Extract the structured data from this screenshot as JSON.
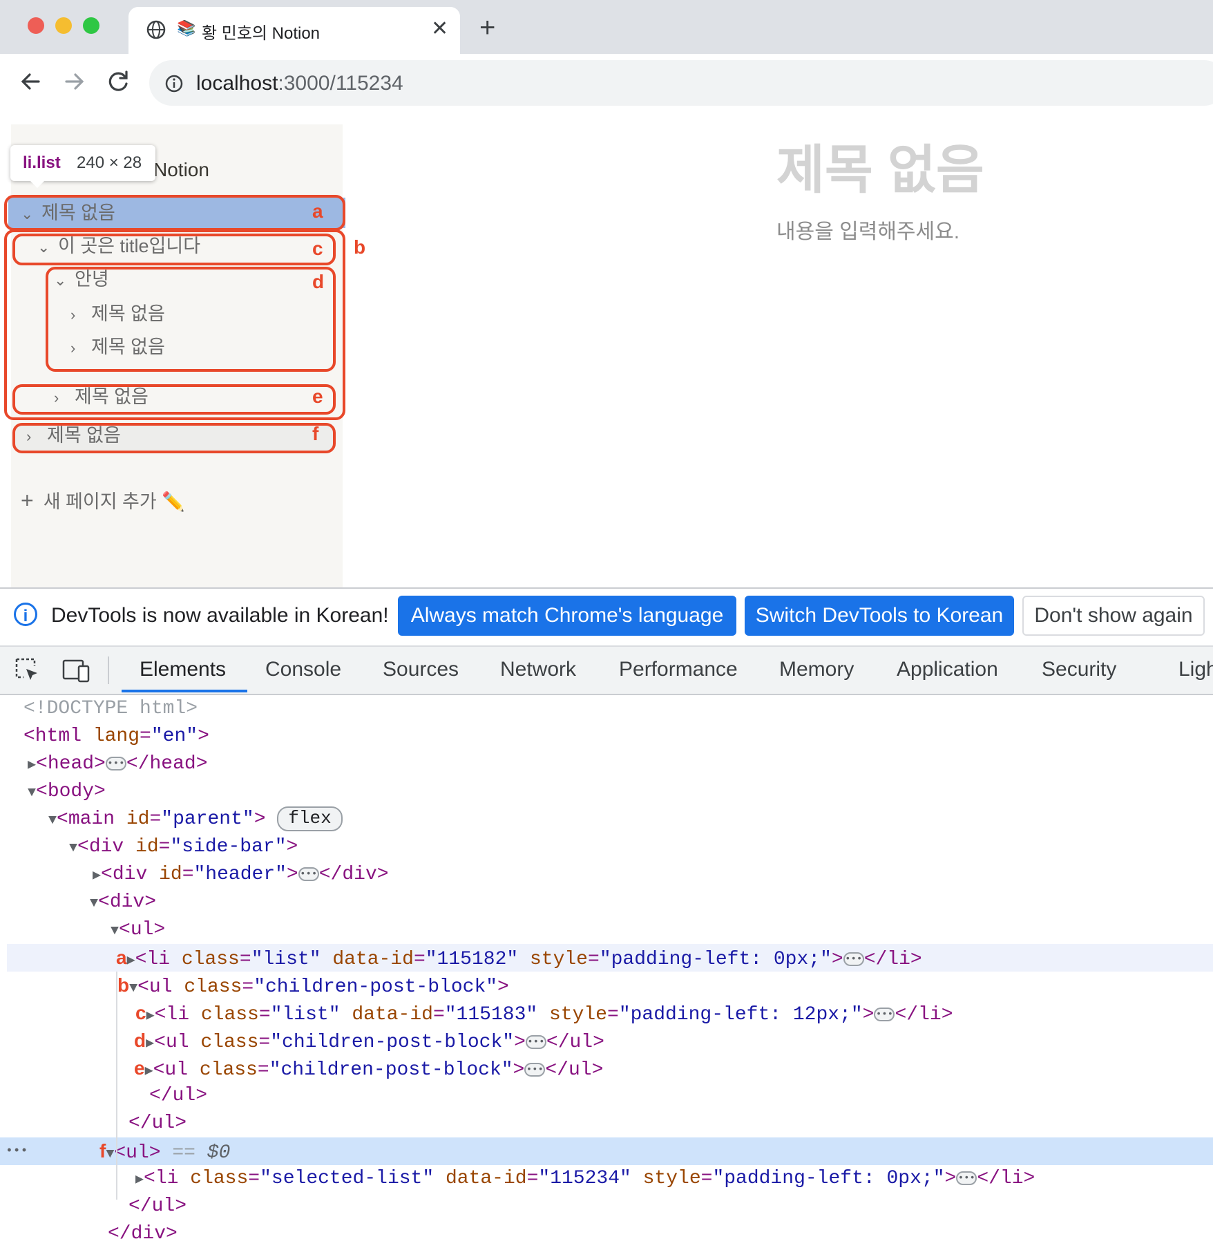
{
  "browser": {
    "tab_title": "황 민호의 Notion",
    "tab_emoji": "📚",
    "close_glyph": "✕",
    "new_tab_glyph": "+",
    "url_host": "localhost",
    "url_path": ":3000/115234"
  },
  "sidebar": {
    "header_title": "Notion",
    "tooltip_selector": "li.list",
    "tooltip_size": "240 × 28",
    "items": [
      {
        "chevron": "⌄",
        "label": "제목 없음",
        "marker": "a"
      },
      {
        "chevron": "⌄",
        "label": "이 곳은 title입니다",
        "marker": "c"
      },
      {
        "chevron": "⌄",
        "label": "안녕",
        "marker": "d"
      },
      {
        "chevron": "›",
        "label": "제목 없음"
      },
      {
        "chevron": "›",
        "label": "제목 없음"
      },
      {
        "chevron": "›",
        "label": "제목 없음",
        "marker": "e"
      },
      {
        "chevron": "›",
        "label": "제목 없음",
        "marker": "f"
      }
    ],
    "group_marker": "b",
    "add_page": "새 페이지 추가 ✏️",
    "add_glyph": "+"
  },
  "main": {
    "title": "제목 없음",
    "content": "내용을  입력해주세요."
  },
  "devtools": {
    "info_glyph": "i",
    "info_message": "DevTools is now available in Korean!",
    "btn_always": "Always match Chrome's language",
    "btn_switch": "Switch DevTools to Korean",
    "btn_dont": "Don't show again",
    "tabs": [
      "Elements",
      "Console",
      "Sources",
      "Network",
      "Performance",
      "Memory",
      "Application",
      "Security",
      "Ligh"
    ],
    "dom": {
      "doctype": "<!DOCTYPE html>",
      "l_html": "<html",
      "l_html_lang": " lang",
      "l_html_lang_val": "\"en\"",
      "gt": ">",
      "head_open": "<head>",
      "head_close": "</head>",
      "body_open": "<body>",
      "main_open": "<main",
      "attr_id": " id",
      "val_parent": "\"parent\"",
      "flex": "flex",
      "div_open": "<div",
      "val_sidebar": "\"side-bar\"",
      "val_header": "\"header\"",
      "div_close": "</div>",
      "div_plain": "<div>",
      "ul_plain": "<ul>",
      "ul_close": "</ul>",
      "li_open": "<li",
      "ul_open": "<ul",
      "attr_class": " class",
      "attr_dataid": " data-id",
      "attr_style": " style",
      "val_list": "\"list\"",
      "val_children": "\"children-post-block\"",
      "val_selected": "\"selected-list\"",
      "val_id_a": "\"115182\"",
      "val_id_c": "\"115183\"",
      "val_id_f": "\"115234\"",
      "val_pad0": "\"padding-left: 0px;\"",
      "val_pad12": "\"padding-left: 12px;\"",
      "li_close": "</li>",
      "eq": "=",
      "eq_dollar": " == ",
      "dollar": "$0",
      "ellipsis": "•••",
      "gutter_dots": "•••",
      "markers": {
        "a": "a",
        "b": "b",
        "c": "c",
        "d": "d",
        "e": "e",
        "f": "f"
      }
    }
  }
}
